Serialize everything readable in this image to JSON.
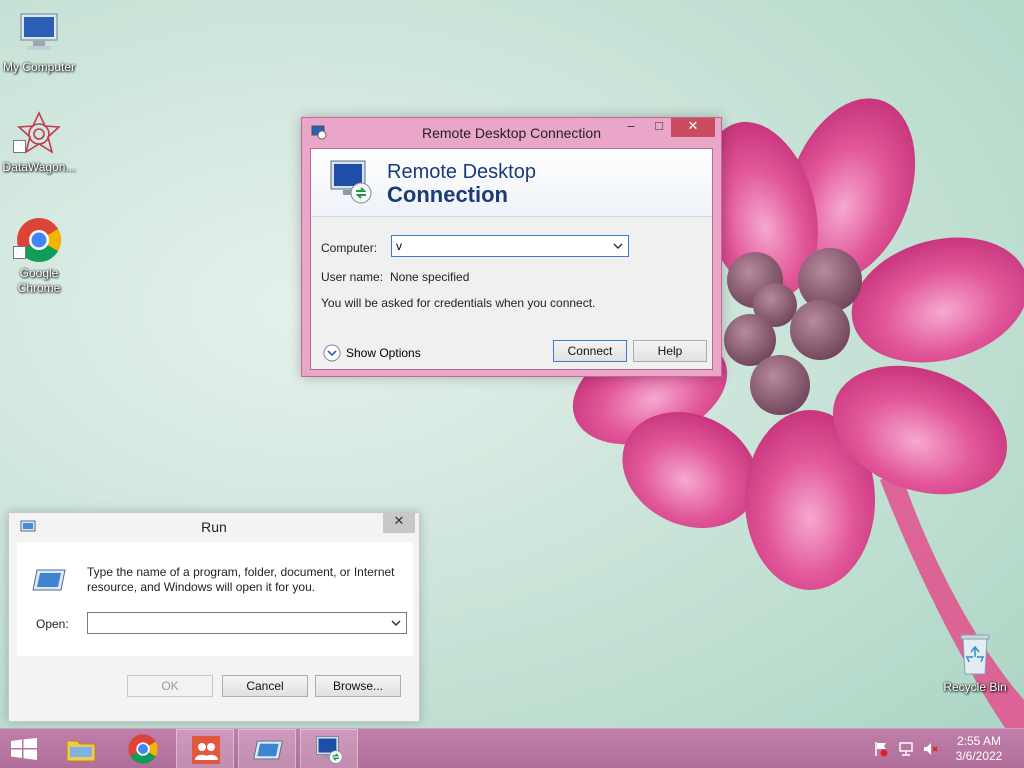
{
  "desktop": {
    "icons": [
      {
        "label": "My Computer",
        "icon": "computer-icon"
      },
      {
        "label": "DataWagon...",
        "icon": "datawagon-icon"
      },
      {
        "label": "Google Chrome",
        "icon": "chrome-icon"
      },
      {
        "label": "Recycle Bin",
        "icon": "recycle-bin-icon"
      }
    ]
  },
  "rdc": {
    "title": "Remote Desktop Connection",
    "banner_line1": "Remote Desktop",
    "banner_line2": "Connection",
    "computer_label": "Computer:",
    "computer_value": "v",
    "username_label": "User name:",
    "username_value": "None specified",
    "note": "You will be asked for credentials when you connect.",
    "show_options": "Show Options",
    "connect": "Connect",
    "help": "Help"
  },
  "run": {
    "title": "Run",
    "description_line1": "Type the name of a program, folder, document, or Internet",
    "description_line2": "resource, and Windows will open it for you.",
    "open_label": "Open:",
    "open_value": "",
    "ok": "OK",
    "cancel": "Cancel",
    "browse": "Browse..."
  },
  "taskbar": {
    "time": "2:55 AM",
    "date": "3/6/2022"
  },
  "colors": {
    "taskbar": "#b06e9a",
    "rdc_frame": "#e9a6c9",
    "close_button": "#c94d5f",
    "banner_text": "#1b3b78"
  }
}
